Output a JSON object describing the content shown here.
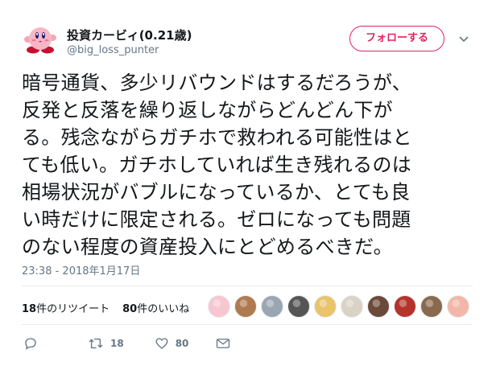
{
  "user": {
    "display_name": "投資カービィ(0.21歳)",
    "handle": "@big_loss_punter"
  },
  "follow_button": {
    "label": "フォローする"
  },
  "tweet": {
    "lines": [
      "暗号通貨、多少リバウンドはするだろうが、",
      "反発と反落を繰り返しながらどんどん下が",
      "る。残念ながらガチホで救われる可能性はと",
      "ても低い。ガチホしていれば生き残れるのは",
      "相場状況がバブルになっているか、とても良",
      "い時だけに限定される。ゼロになっても問題",
      "のない程度の資産投入にとどめるべきだ。"
    ],
    "timestamp": "23:38 - 2018年1月17日"
  },
  "stats": {
    "retweet_count": "18",
    "retweet_suffix": "件のリツイート",
    "like_count": "80",
    "like_suffix": "件のいいね"
  },
  "likers": [
    {
      "icon": "kirby-avatar",
      "color": "#f7c6d0"
    },
    {
      "icon": "food-avatar",
      "color": "#b07a4f"
    },
    {
      "icon": "default-avatar",
      "color": "#9aa7b2"
    },
    {
      "icon": "monochrome-avatar",
      "color": "#555555"
    },
    {
      "icon": "cartoon-avatar",
      "color": "#e9c46a"
    },
    {
      "icon": "cat-avatar",
      "color": "#d9d2c5"
    },
    {
      "icon": "glasses-avatar",
      "color": "#6b4a3a"
    },
    {
      "icon": "red-avatar",
      "color": "#b5332b"
    },
    {
      "icon": "portrait-avatar",
      "color": "#8a6a4f"
    },
    {
      "icon": "anime-avatar",
      "color": "#f2b7a8"
    }
  ],
  "actions": {
    "retweet_count": "18",
    "like_count": "80"
  },
  "colors": {
    "accent": "#e0245e",
    "secondary_text": "#657786",
    "divider": "#e6ecf0"
  }
}
